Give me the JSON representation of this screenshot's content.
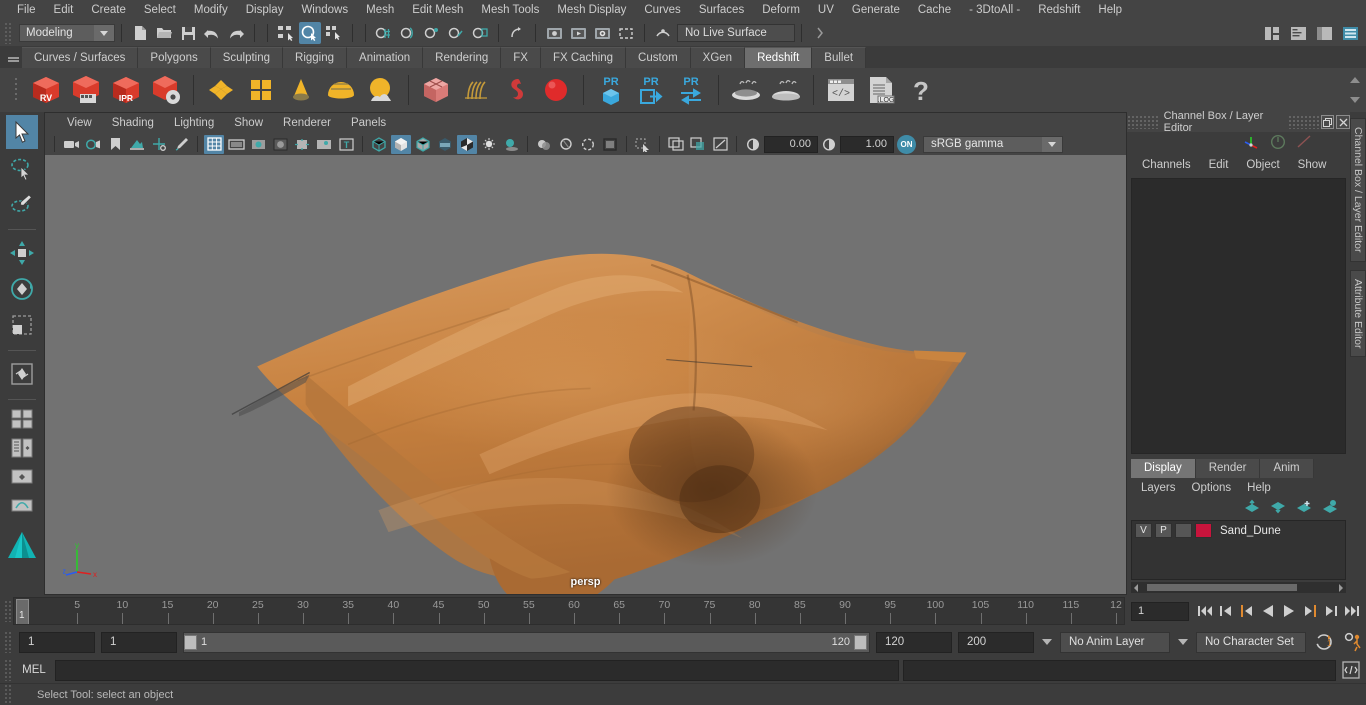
{
  "menubar": {
    "items": [
      "File",
      "Edit",
      "Create",
      "Select",
      "Modify",
      "Display",
      "Windows",
      "Mesh",
      "Edit Mesh",
      "Mesh Tools",
      "Mesh Display",
      "Curves",
      "Surfaces",
      "Deform",
      "UV",
      "Generate",
      "Cache",
      "- 3DtoAll -",
      "Redshift",
      "Help"
    ]
  },
  "statusbar": {
    "mode": "Modeling",
    "live_surface": "No Live Surface",
    "icons": {
      "new_scene": "new-file-icon",
      "open_scene": "open-folder-icon",
      "save_scene": "save-disk-icon",
      "undo": "undo-arrow-icon",
      "redo": "redo-arrow-icon",
      "select_hierarchy": "select-hierarchy-icon",
      "select_object": "select-object-icon",
      "select_component": "select-component-icon",
      "snap_grid": "snap-to-grid-icon",
      "snap_curve": "snap-to-curve-icon",
      "snap_point": "snap-to-point-icon",
      "snap_projected": "snap-to-projected-icon",
      "snap_view": "snap-to-view-plane-icon",
      "render_current": "render-current-frame-icon",
      "ipr_render": "ipr-render-icon",
      "render_settings": "render-settings-icon",
      "outliner": "outliner-icon",
      "hypergraph": "hypergraph-icon",
      "attribute_editor": "attribute-editor-icon",
      "tool_settings": "tool-settings-icon",
      "channel_box": "channel-box-icon"
    }
  },
  "shelf": {
    "tabs": [
      "Curves / Surfaces",
      "Polygons",
      "Sculpting",
      "Rigging",
      "Animation",
      "Rendering",
      "FX",
      "FX Caching",
      "Custom",
      "XGen",
      "Redshift",
      "Bullet"
    ],
    "active_tab": "Redshift",
    "buttons": [
      {
        "name": "redshift-render-view",
        "label": "RV"
      },
      {
        "name": "redshift-render-sequence",
        "label": ""
      },
      {
        "name": "redshift-ipr-render",
        "label": "IPR"
      },
      {
        "name": "redshift-render-settings",
        "label": ""
      },
      {
        "name": "redshift-material",
        "label": ""
      },
      {
        "name": "redshift-material-blender",
        "label": ""
      },
      {
        "name": "redshift-light-ies",
        "label": ""
      },
      {
        "name": "redshift-dome-light",
        "label": ""
      },
      {
        "name": "redshift-environment",
        "label": ""
      },
      {
        "name": "redshift-proxy-cube",
        "label": ""
      },
      {
        "name": "redshift-hair",
        "label": ""
      },
      {
        "name": "redshift-volume",
        "label": ""
      },
      {
        "name": "redshift-sphere-light",
        "label": ""
      },
      {
        "name": "redshift-proxy-create",
        "label": "PR"
      },
      {
        "name": "redshift-proxy-export",
        "label": "PR"
      },
      {
        "name": "redshift-proxy-swap",
        "label": "PR"
      },
      {
        "name": "redshift-bake-set",
        "label": ""
      },
      {
        "name": "redshift-bake-render",
        "label": ""
      },
      {
        "name": "redshift-script-editor",
        "label": ""
      },
      {
        "name": "redshift-log",
        "label": ".LOG"
      },
      {
        "name": "redshift-help",
        "label": "?"
      }
    ]
  },
  "toolbox": {
    "tools": [
      {
        "name": "select-tool",
        "selected": true
      },
      {
        "name": "lasso-select-tool",
        "selected": false
      },
      {
        "name": "paint-select-tool",
        "selected": false
      },
      {
        "name": "move-tool",
        "selected": false
      },
      {
        "name": "rotate-tool",
        "selected": false
      },
      {
        "name": "scale-tool",
        "selected": false
      },
      {
        "name": "last-tool",
        "selected": false
      }
    ],
    "layouts": [
      {
        "name": "layout-single-pane"
      },
      {
        "name": "layout-four-pane"
      },
      {
        "name": "layout-outliner-persp"
      },
      {
        "name": "layout-persp-graph"
      }
    ]
  },
  "viewport": {
    "menu": [
      "View",
      "Shading",
      "Lighting",
      "Show",
      "Renderer",
      "Panels"
    ],
    "camera_label": "persp",
    "exposure": "0.00",
    "gamma": "1.00",
    "color_management": "sRGB gamma",
    "view_transform_enabled": "ON",
    "axis": {
      "x": "x",
      "y": "y",
      "z": "z",
      "x_color": "#e02020",
      "y_color": "#29cc29",
      "z_color": "#2a5cf0"
    },
    "background_color": "#727272",
    "object_color": "#c6813f"
  },
  "channelbox": {
    "title": "Channel Box / Layer Editor",
    "menu": [
      "Channels",
      "Edit",
      "Object",
      "Show"
    ],
    "vertical_tabs": [
      "Channel Box / Layer Editor",
      "Attribute Editor"
    ],
    "window_buttons": {
      "restore": "restore-window-icon",
      "close": "close-window-icon"
    }
  },
  "layereditor": {
    "tabs": [
      "Display",
      "Render",
      "Anim"
    ],
    "active_tab": "Display",
    "menu": [
      "Layers",
      "Options",
      "Help"
    ],
    "buttons": [
      {
        "name": "move-layer-up-button"
      },
      {
        "name": "move-layer-down-button"
      },
      {
        "name": "create-empty-layer-button"
      },
      {
        "name": "create-layer-from-selected-button"
      }
    ],
    "layers": [
      {
        "visibility": "V",
        "playback": "P",
        "type": "",
        "color": "#c8143c",
        "name": "Sand_Dune"
      }
    ]
  },
  "timeline": {
    "current_frame": "1",
    "start": 1,
    "end": 120,
    "tick_labels": [
      "5",
      "10",
      "15",
      "20",
      "25",
      "30",
      "35",
      "40",
      "45",
      "50",
      "55",
      "60",
      "65",
      "70",
      "75",
      "80",
      "85",
      "90",
      "95",
      "100",
      "105",
      "110",
      "115",
      "12"
    ],
    "playback_buttons": [
      {
        "name": "go-to-start-button"
      },
      {
        "name": "step-back-frame-button"
      },
      {
        "name": "step-back-key-button"
      },
      {
        "name": "play-backwards-button"
      },
      {
        "name": "play-forwards-button"
      },
      {
        "name": "step-forward-key-button"
      },
      {
        "name": "step-forward-frame-button"
      },
      {
        "name": "go-to-end-button"
      }
    ]
  },
  "rangeslider": {
    "anim_start": "1",
    "range_start": "1",
    "bar_min": "1",
    "bar_max": "120",
    "range_end": "120",
    "anim_end": "200",
    "anim_layer": "No Anim Layer",
    "character_set": "No Character Set",
    "icons": {
      "auto_keyframe": "auto-keyframe-icon",
      "animation_preferences": "animation-preferences-icon"
    }
  },
  "commandline": {
    "language_label": "MEL",
    "command_value": "",
    "script_editor_icon": "script-editor-icon"
  },
  "helpline": {
    "text": "Select Tool: select an object"
  }
}
